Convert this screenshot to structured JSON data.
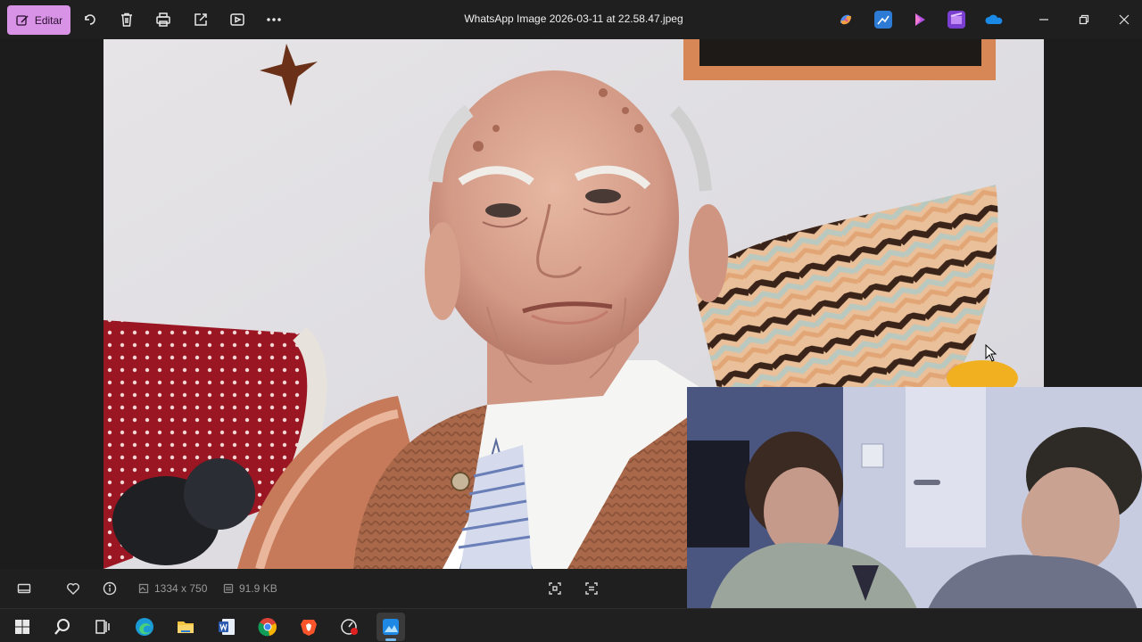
{
  "toolbar": {
    "edit_label": "Editar",
    "icons": [
      "rotate-icon",
      "delete-icon",
      "print-icon",
      "share-icon",
      "slideshow-icon",
      "more-icon"
    ]
  },
  "window": {
    "title": "WhatsApp Image 2026-03-11 at 22.58.47.jpeg"
  },
  "statusbar": {
    "dimensions": "1334 x 750",
    "filesize": "91.9 KB"
  },
  "colors": {
    "edit_accent": "#d993e6",
    "background": "#1c1c1c",
    "taskbar_indicator": "#76b9ed"
  }
}
